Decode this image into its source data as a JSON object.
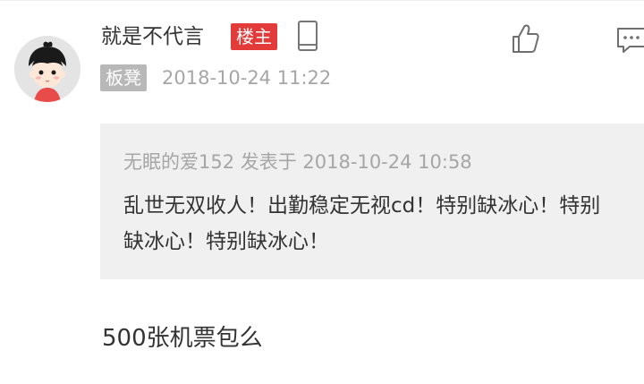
{
  "post": {
    "username": "就是不代言",
    "owner_badge": "楼主",
    "device_icon": "phone-icon",
    "floor_badge": "板凳",
    "timestamp": "2018-10-24 11:22",
    "quote": {
      "meta": "无眠的爱152 发表于 2018-10-24 10:58",
      "text": "乱世无双收人！出勤稳定无视cd！特别缺冰心！特别缺冰心！特别缺冰心！"
    },
    "reply": "500张机票包么"
  },
  "actions": {
    "like_icon": "thumbs-up-icon",
    "comment_icon": "comment-icon"
  },
  "colors": {
    "owner_badge": "#e33a3a",
    "floor_badge": "#b8b8b8",
    "quote_bg": "#f0f0f0"
  }
}
